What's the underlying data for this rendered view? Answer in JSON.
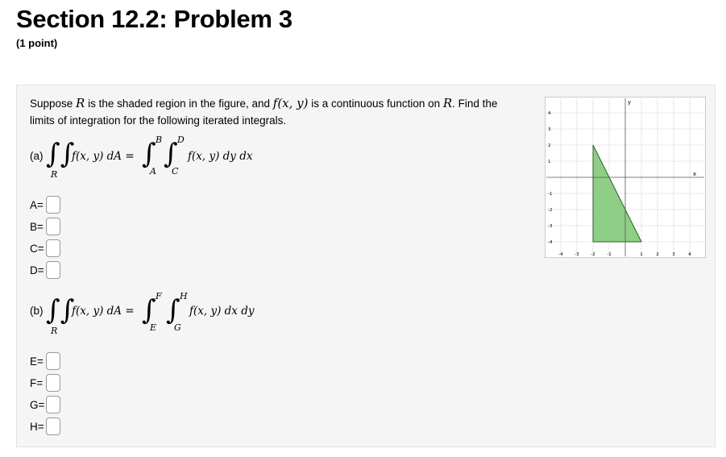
{
  "header": {
    "title": "Section 12.2: Problem 3",
    "points": "(1 point)"
  },
  "problem": {
    "text_1": "Suppose ",
    "R": "R",
    "text_2": " is the shaded region in the figure, and ",
    "f": "f(x, y)",
    "text_3": " is a continuous function on ",
    "text_4": ". Find the limits of integration for the following iterated integrals."
  },
  "part_a": {
    "label": "(a)",
    "lhs": "f(x, y) dA =",
    "region": "R",
    "upper_outer": "B",
    "lower_outer": "A",
    "upper_inner": "D",
    "lower_inner": "C",
    "integrand": "f(x, y) dy dx",
    "fields": [
      {
        "label": "A=",
        "value": ""
      },
      {
        "label": "B=",
        "value": ""
      },
      {
        "label": "C=",
        "value": ""
      },
      {
        "label": "D=",
        "value": ""
      }
    ]
  },
  "part_b": {
    "label": "(b)",
    "lhs": "f(x, y) dA =",
    "region": "R",
    "upper_outer": "F",
    "lower_outer": "E",
    "upper_inner": "H",
    "lower_inner": "G",
    "integrand": "f(x, y) dx dy",
    "fields": [
      {
        "label": "E=",
        "value": ""
      },
      {
        "label": "F=",
        "value": ""
      },
      {
        "label": "G=",
        "value": ""
      },
      {
        "label": "H=",
        "value": ""
      }
    ]
  },
  "graph": {
    "x_label": "x",
    "y_label": "y",
    "x_ticks": [
      "-4",
      "-3",
      "-2",
      "-1",
      "1",
      "2",
      "3",
      "4"
    ],
    "y_ticks": [
      "4",
      "3",
      "2",
      "1",
      "-1",
      "-2",
      "-3",
      "-4"
    ],
    "xlim": [
      -4.5,
      4.5
    ],
    "ylim": [
      -4.5,
      4.5
    ],
    "region_vertices": [
      [
        -2,
        2
      ],
      [
        -2,
        -4
      ],
      [
        1,
        -4
      ]
    ],
    "fill_color": "#8fce86",
    "grid": true
  }
}
